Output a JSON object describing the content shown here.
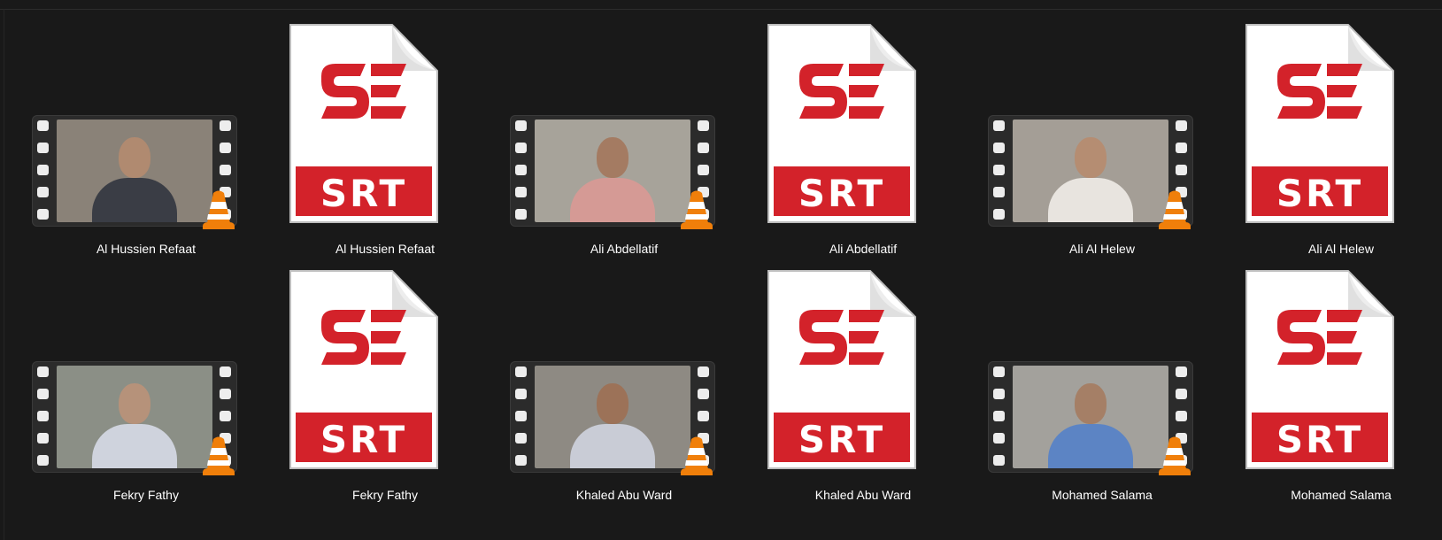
{
  "files": [
    {
      "type": "video",
      "name": "Al Hussien Refaat",
      "bg": "#8a8278",
      "shirt": "#3a3d45",
      "skin": "#b08a70"
    },
    {
      "type": "srt",
      "name": "Al Hussien Refaat"
    },
    {
      "type": "video",
      "name": "Ali Abdellatif",
      "bg": "#a7a39a",
      "shirt": "#d59a95",
      "skin": "#a47b62"
    },
    {
      "type": "srt",
      "name": "Ali Abdellatif"
    },
    {
      "type": "video",
      "name": "Ali Al Helew",
      "bg": "#a49e96",
      "shirt": "#e8e4df",
      "skin": "#b58d72"
    },
    {
      "type": "srt",
      "name": "Ali Al Helew"
    },
    {
      "type": "video",
      "name": "Fekry Fathy",
      "bg": "#8b8f86",
      "shirt": "#cfd3dd",
      "skin": "#b6927a"
    },
    {
      "type": "srt",
      "name": "Fekry Fathy"
    },
    {
      "type": "video",
      "name": "Khaled Abu Ward",
      "bg": "#8e8a83",
      "shirt": "#c9ccd6",
      "skin": "#9c7258"
    },
    {
      "type": "srt",
      "name": "Khaled Abu Ward"
    },
    {
      "type": "video",
      "name": "Mohamed Salama",
      "bg": "#a3a19c",
      "shirt": "#5c84c4",
      "skin": "#a57f66"
    },
    {
      "type": "srt",
      "name": "Mohamed Salama"
    }
  ],
  "srt_icon": {
    "logo_text": "SE",
    "badge_text": "SRT",
    "accent": "#d3222a"
  },
  "colors": {
    "background": "#191919",
    "label": "#ffffff",
    "vlc_orange": "#f07f0a"
  }
}
